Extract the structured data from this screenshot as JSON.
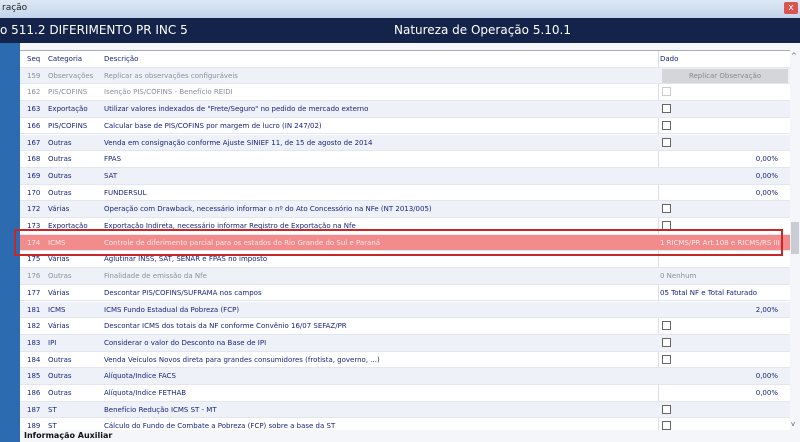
{
  "window": {
    "title": "ração",
    "close": "x"
  },
  "header": {
    "left": "o 511.2   DIFERIMENTO PR INC 5",
    "right": "Natureza de Operação 5.10.1"
  },
  "columns": [
    "Seq",
    "Categoria",
    "Descrição",
    "Dado"
  ],
  "replicate_button": "Replicar Observação",
  "rows": [
    {
      "seq": "159",
      "cat": "Observações",
      "desc": "Replicar as observações configuráveis",
      "dado": "",
      "type": "button",
      "disabled": true
    },
    {
      "seq": "162",
      "cat": "PIS/COFINS",
      "desc": "Isenção PIS/COFINS - Benefício REIDI",
      "dado": "",
      "type": "checkbox",
      "disabled": true
    },
    {
      "seq": "163",
      "cat": "Exportação",
      "desc": "Utilizar valores indexados de \"Frete/Seguro\" no pedido de mercado externo",
      "dado": "",
      "type": "checkbox"
    },
    {
      "seq": "166",
      "cat": "PIS/COFINS",
      "desc": "Calcular base de PIS/COFINS por margem de lucro (IN 247/02)",
      "dado": "",
      "type": "checkbox"
    },
    {
      "seq": "167",
      "cat": "Outras",
      "desc": "Venda em consignação conforme Ajuste SINIEF 11, de 15 de agosto de 2014",
      "dado": "",
      "type": "checkbox"
    },
    {
      "seq": "168",
      "cat": "Outras",
      "desc": "FPAS",
      "dado": "0,00%",
      "type": "right"
    },
    {
      "seq": "169",
      "cat": "Outras",
      "desc": "SAT",
      "dado": "0,00%",
      "type": "right"
    },
    {
      "seq": "170",
      "cat": "Outras",
      "desc": "FUNDERSUL",
      "dado": "0,00%",
      "type": "right"
    },
    {
      "seq": "172",
      "cat": "Várias",
      "desc": "Operação com Drawback, necessário informar o nº do Ato Concessório na NFe (NT 2013/005)",
      "dado": "",
      "type": "checkbox"
    },
    {
      "seq": "173",
      "cat": "Exportação",
      "desc": "Exportação Indireta, necessário informar Registro de Exportação na Nfe",
      "dado": "",
      "type": "checkbox"
    },
    {
      "seq": "174",
      "cat": "ICMS",
      "desc": "Controle de diferimento parcial para os estados do Rio Grande do Sul e Paraná",
      "dado": "1 RICMS/PR Art.108 e RICMS/RS III",
      "type": "text",
      "selected": true
    },
    {
      "seq": "175",
      "cat": "Várias",
      "desc": "Aglutinar INSS, SAT, SENAR e FPAS no imposto",
      "dado": "",
      "type": "text"
    },
    {
      "seq": "176",
      "cat": "Outras",
      "desc": "Finalidade de emissão da Nfe",
      "dado": "0  Nenhum",
      "type": "text",
      "disabled": true
    },
    {
      "seq": "177",
      "cat": "Várias",
      "desc": "Descontar PIS/COFINS/SUFRAMA nos campos",
      "dado": "05 Total NF e Total Faturado",
      "type": "text"
    },
    {
      "seq": "181",
      "cat": "ICMS",
      "desc": "ICMS Fundo Estadual da Pobreza (FCP)",
      "dado": "2,00%",
      "type": "right"
    },
    {
      "seq": "182",
      "cat": "Várias",
      "desc": "Descontar ICMS dos totais da NF conforme Convênio 16/07 SEFAZ/PR",
      "dado": "",
      "type": "checkbox"
    },
    {
      "seq": "183",
      "cat": "IPI",
      "desc": "Considerar o valor do Desconto na Base de IPI",
      "dado": "",
      "type": "checkbox"
    },
    {
      "seq": "184",
      "cat": "Outras",
      "desc": "Venda Veículos Novos direta para grandes consumidores (frotista, governo, ...)",
      "dado": "",
      "type": "checkbox"
    },
    {
      "seq": "185",
      "cat": "Outras",
      "desc": "Alíquota/Indice FACS",
      "dado": "0,00%",
      "type": "right"
    },
    {
      "seq": "186",
      "cat": "Outras",
      "desc": "Alíquota/Indice FETHAB",
      "dado": "0,00%",
      "type": "right"
    },
    {
      "seq": "187",
      "cat": "ST",
      "desc": "Benefício Redução ICMS ST - MT",
      "dado": "",
      "type": "checkbox"
    },
    {
      "seq": "189",
      "cat": "ST",
      "desc": "Cálculo do Fundo de Combate a Pobreza (FCP) sobre a base da ST",
      "dado": "",
      "type": "checkbox"
    }
  ],
  "info_label": "Informação Auxiliar"
}
